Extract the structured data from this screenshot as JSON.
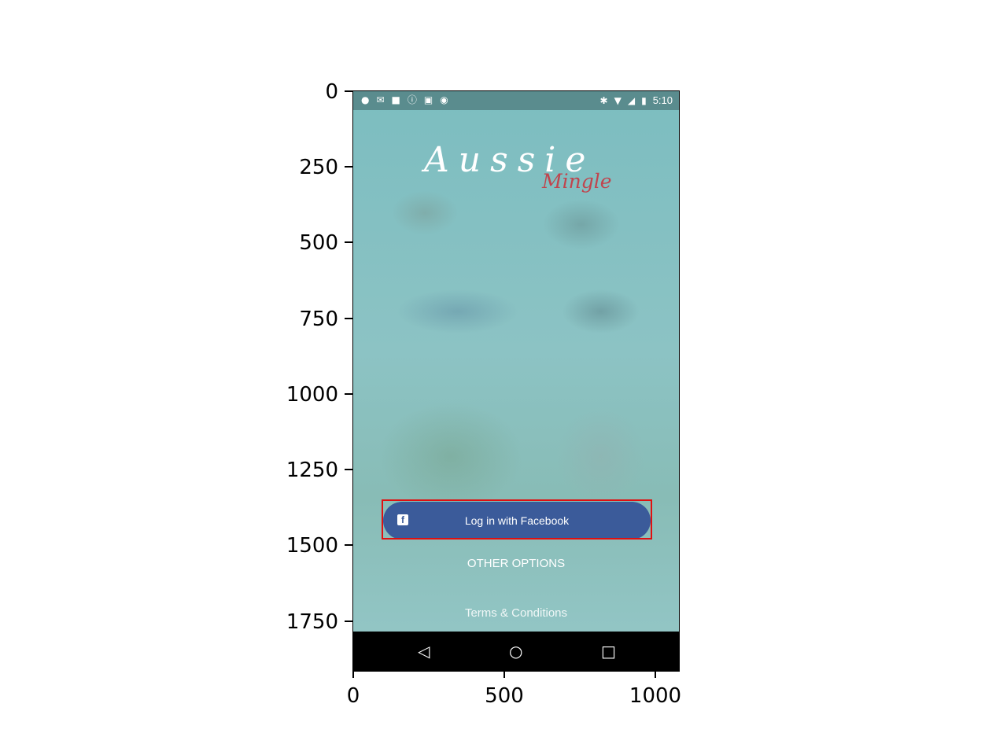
{
  "axes": {
    "y_ticks": [
      "0",
      "250",
      "500",
      "750",
      "1000",
      "1250",
      "1500",
      "1750"
    ],
    "x_ticks": [
      "0",
      "500",
      "1000"
    ]
  },
  "status_bar": {
    "time": "5:10",
    "left_icons": [
      "keyhole-icon",
      "mail-icon",
      "facebook-icon",
      "alert-icon",
      "lock-icon",
      "android-icon"
    ],
    "right_icons": [
      "bluetooth-icon",
      "wifi-icon",
      "no-signal-icon",
      "battery-charging-icon"
    ]
  },
  "logo": {
    "main": "Aussie",
    "sub": "Mingle"
  },
  "login": {
    "facebook_label": "Log in with Facebook",
    "facebook_icon": "f",
    "other_options": "OTHER OPTIONS",
    "terms": "Terms & Conditions"
  },
  "nav": {
    "back": "◁",
    "home": "○",
    "recents": "□"
  },
  "colors": {
    "facebook_blue": "#3b5b9a",
    "highlight": "#e01010",
    "logo_sub": "#c0454e"
  }
}
